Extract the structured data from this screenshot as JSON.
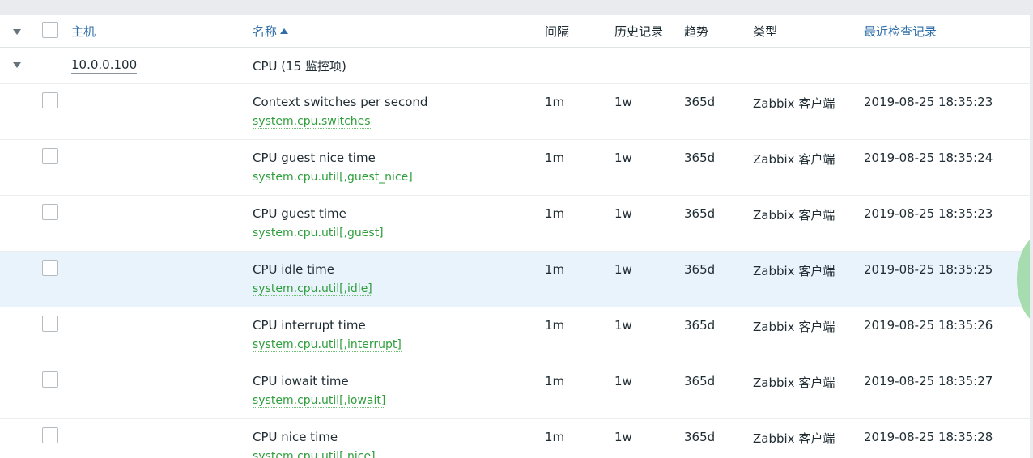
{
  "header": {
    "col_host": "主机",
    "col_name": "名称",
    "col_interval": "间隔",
    "col_history": "历史记录",
    "col_trends": "趋势",
    "col_type": "类型",
    "col_last_check": "最近检查记录"
  },
  "group": {
    "host": "10.0.0.100",
    "app_name": "CPU",
    "count_text": "(15 监控项)"
  },
  "items": [
    {
      "name": "Context switches per second",
      "key": "system.cpu.switches",
      "interval": "1m",
      "history": "1w",
      "trends": "365d",
      "type": "Zabbix 客户端",
      "last_check": "2019-08-25 18:35:23"
    },
    {
      "name": "CPU guest nice time",
      "key": "system.cpu.util[,guest_nice]",
      "interval": "1m",
      "history": "1w",
      "trends": "365d",
      "type": "Zabbix 客户端",
      "last_check": "2019-08-25 18:35:24"
    },
    {
      "name": "CPU guest time",
      "key": "system.cpu.util[,guest]",
      "interval": "1m",
      "history": "1w",
      "trends": "365d",
      "type": "Zabbix 客户端",
      "last_check": "2019-08-25 18:35:23"
    },
    {
      "name": "CPU idle time",
      "key": "system.cpu.util[,idle]",
      "interval": "1m",
      "history": "1w",
      "trends": "365d",
      "type": "Zabbix 客户端",
      "last_check": "2019-08-25 18:35:25"
    },
    {
      "name": "CPU interrupt time",
      "key": "system.cpu.util[,interrupt]",
      "interval": "1m",
      "history": "1w",
      "trends": "365d",
      "type": "Zabbix 客户端",
      "last_check": "2019-08-25 18:35:26"
    },
    {
      "name": "CPU iowait time",
      "key": "system.cpu.util[,iowait]",
      "interval": "1m",
      "history": "1w",
      "trends": "365d",
      "type": "Zabbix 客户端",
      "last_check": "2019-08-25 18:35:27"
    },
    {
      "name": "CPU nice time",
      "key": "system.cpu.util[,nice]",
      "interval": "1m",
      "history": "1w",
      "trends": "365d",
      "type": "Zabbix 客户端",
      "last_check": "2019-08-25 18:35:28"
    }
  ],
  "colors": {
    "link": "#2f6ea8",
    "item_key": "#2f9e3c",
    "highlight_row": "#e9f3fc"
  }
}
